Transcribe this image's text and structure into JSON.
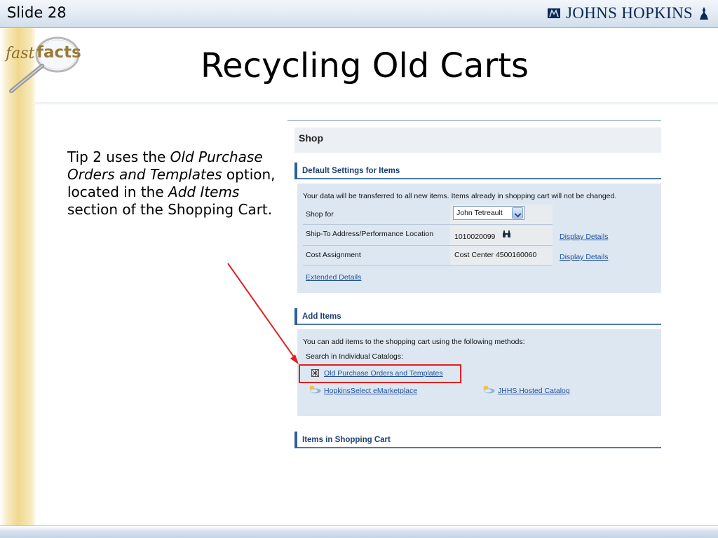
{
  "header": {
    "slide_number": "Slide 28",
    "brand": "JOHNS HOPKINS"
  },
  "logo": {
    "fast": "fast",
    "facts": "facts"
  },
  "title": "Recycling Old Carts",
  "tip": {
    "part1": "Tip 2 uses the ",
    "italic1": "Old Purchase Orders and Templates",
    "part2": " option, located in the ",
    "italic2": "Add Items",
    "part3": " section of the Shopping Cart."
  },
  "screenshot": {
    "shop_title": "Shop",
    "default_settings": {
      "heading": "Default Settings for Items",
      "note": "Your data will be transferred to all new items. Items already in shopping cart will not be changed.",
      "shop_for_label": "Shop for",
      "shop_for_value": "John Tetreault",
      "ship_to_label": "Ship-To Address/Performance Location",
      "ship_to_value": "1010020099",
      "cost_label": "Cost Assignment",
      "cost_value": "Cost Center  4500160060",
      "display_details": "Display Details",
      "extended_details": "Extended Details"
    },
    "add_items": {
      "heading": "Add Items",
      "intro": "You can add items to the shopping cart using the following methods:",
      "search_label": "Search in Individual Catalogs:",
      "old_po_link": "Old Purchase Orders and Templates",
      "hopkins_link": "HopkinsSelect eMarketplace",
      "jhhs_link": "JHHS Hosted Catalog"
    },
    "cart_heading": "Items in Shopping Cart"
  },
  "colors": {
    "highlight": "#e02020",
    "section_blue": "#2f5f9a",
    "panel": "#dde7f2"
  }
}
